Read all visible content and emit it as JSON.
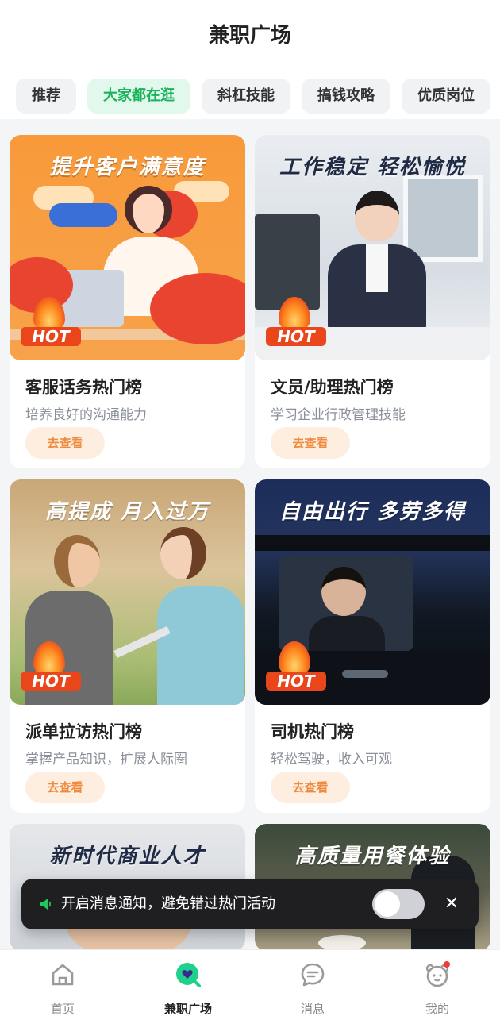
{
  "header": {
    "title": "兼职广场"
  },
  "tabs": [
    {
      "label": "推荐",
      "active": false
    },
    {
      "label": "大家都在逛",
      "active": true
    },
    {
      "label": "斜杠技能",
      "active": false
    },
    {
      "label": "搞钱攻略",
      "active": false
    },
    {
      "label": "优质岗位",
      "active": false
    }
  ],
  "cards": [
    {
      "image_headline": "提升客户满意度",
      "badge": "HOT",
      "name": "客服话务热门榜",
      "desc": "培养良好的沟通能力",
      "button": "去查看"
    },
    {
      "image_headline": "工作稳定  轻松愉悦",
      "badge": "HOT",
      "name": "文员/助理热门榜",
      "desc": "学习企业行政管理技能",
      "button": "去查看"
    },
    {
      "image_headline": "高提成  月入过万",
      "badge": "HOT",
      "name": "派单拉访热门榜",
      "desc": "掌握产品知识，扩展人际圈",
      "button": "去查看"
    },
    {
      "image_headline": "自由出行  多劳多得",
      "badge": "HOT",
      "name": "司机热门榜",
      "desc": "轻松驾驶，收入可观",
      "button": "去查看"
    },
    {
      "image_headline": "新时代商业人才"
    },
    {
      "image_headline": "高质量用餐体验"
    }
  ],
  "toast": {
    "text": "开启消息通知，避免错过热门活动",
    "toggle_on": false
  },
  "bottom_nav": [
    {
      "label": "首页",
      "icon": "home-icon",
      "active": false
    },
    {
      "label": "兼职广场",
      "icon": "heart-search-icon",
      "active": true
    },
    {
      "label": "消息",
      "icon": "message-icon",
      "active": false
    },
    {
      "label": "我的",
      "icon": "bear-face-icon",
      "active": false
    }
  ],
  "colors": {
    "accent_green": "#18b35a",
    "active_tab_bg": "#e3f8ec",
    "button_bg": "#fdeee0",
    "button_text": "#f08a3c",
    "hot_red": "#e9461b"
  }
}
